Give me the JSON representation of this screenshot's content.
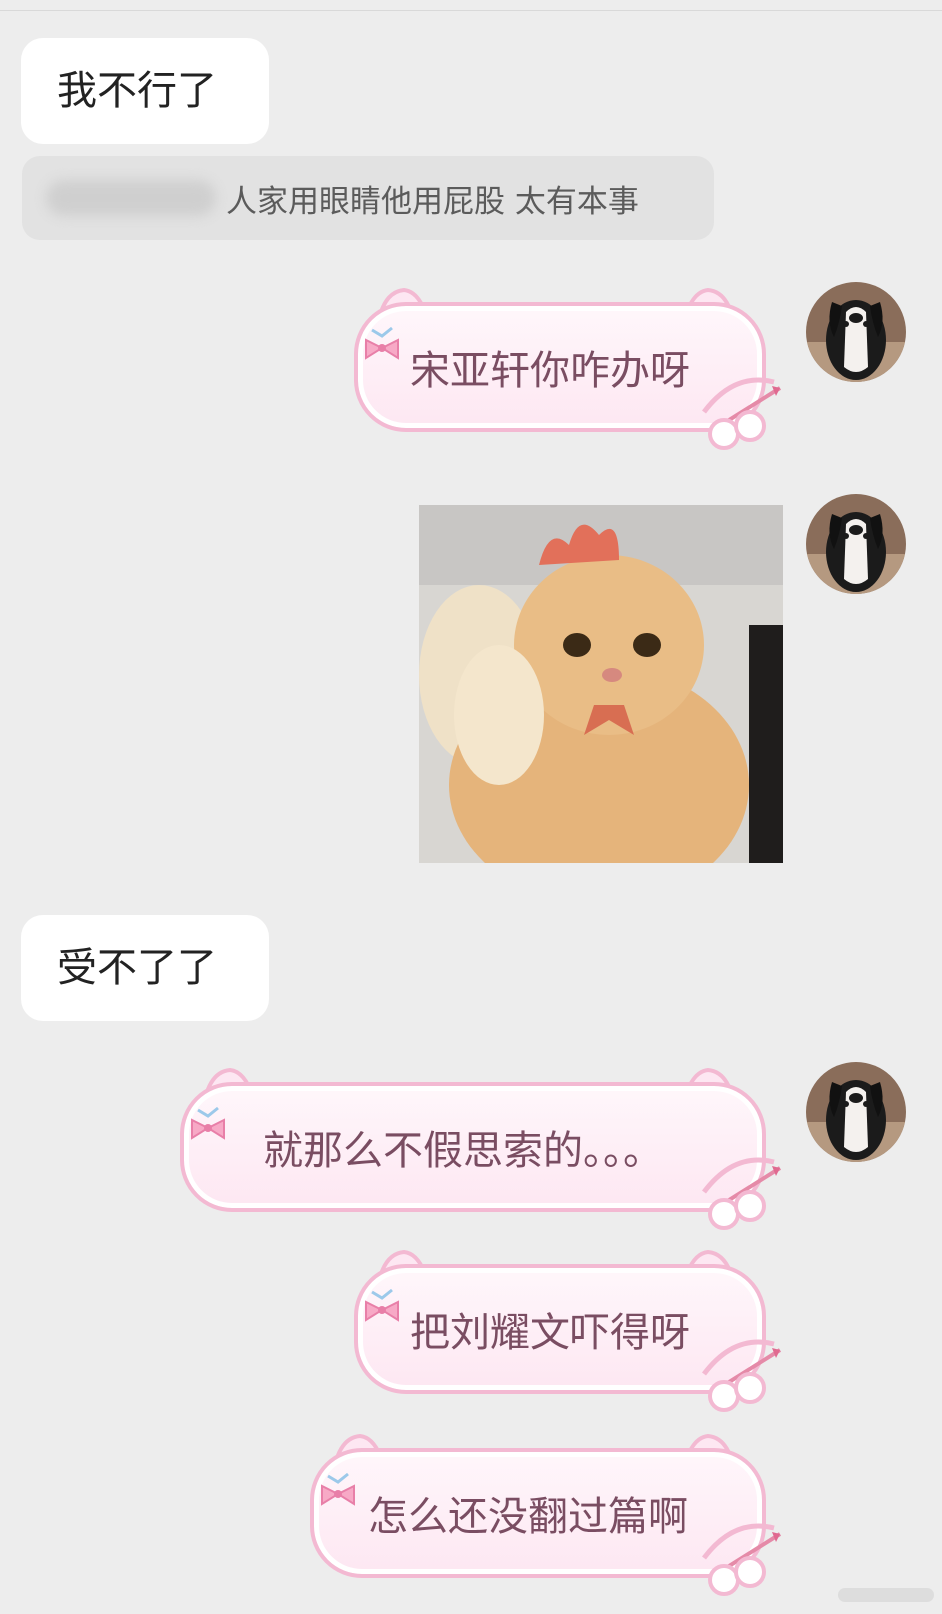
{
  "messages": {
    "m1": {
      "text": "我不行了"
    },
    "quote": {
      "text": "人家用眼睛他用屁股 太有本事"
    },
    "m2": {
      "text": "宋亚轩你咋办呀"
    },
    "m4": {
      "text": "受不了了"
    },
    "m5": {
      "text": "就那么不假思索的。。。"
    },
    "m6": {
      "text": "把刘耀文吓得呀"
    },
    "m7": {
      "text": "怎么还没翻过篇啊"
    }
  },
  "colors": {
    "background": "#ededed",
    "bubble_in": "#ffffff",
    "quote_bg": "#e2e2e2",
    "bubble_out_border": "#f3b9d2",
    "bubble_out_text": "#7a4d62"
  },
  "icons": {
    "avatar": "dog-avatar-icon",
    "bow": "ribbon-bow-icon",
    "deco": "cupid-bow-arrow-icon"
  }
}
